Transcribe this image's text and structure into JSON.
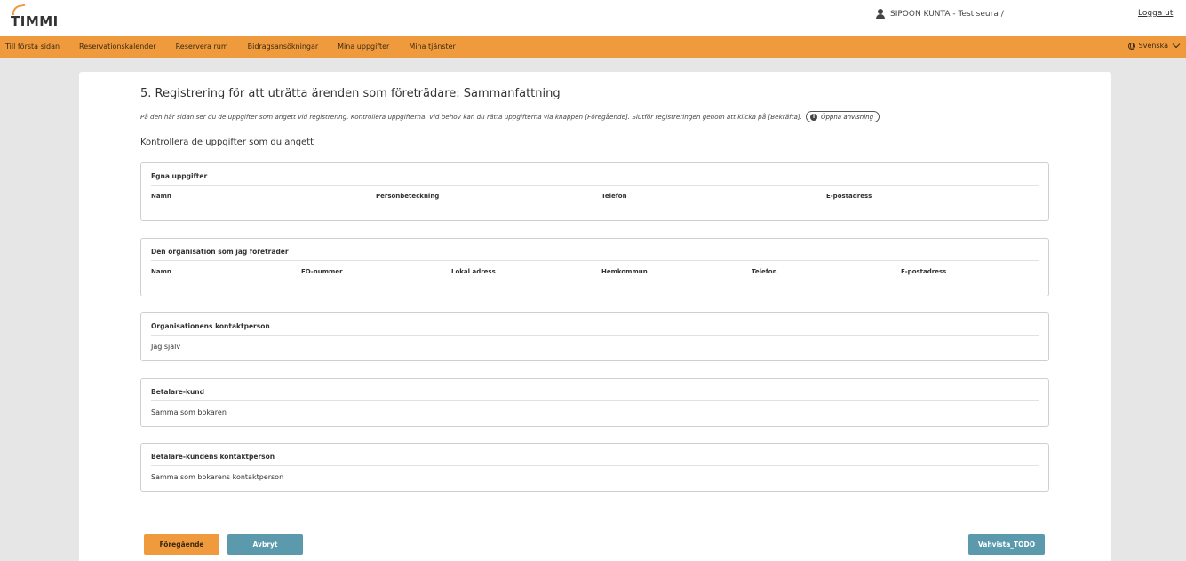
{
  "header": {
    "logo_text": "TIMMI",
    "user_label": "SIPOON KUNTA - Testiseura /",
    "logout_label": "Logga ut"
  },
  "nav": {
    "items": [
      {
        "label": "Till första sidan"
      },
      {
        "label": "Reservationskalender"
      },
      {
        "label": "Reservera rum"
      },
      {
        "label": "Bidragsansökningar"
      },
      {
        "label": "Mina uppgifter"
      },
      {
        "label": "Mina tjänster"
      }
    ],
    "language": "Svenska"
  },
  "main": {
    "title": "5. Registrering för att uträtta ärenden som företrädare: Sammanfattning",
    "intro": "På den här sidan ser du de uppgifter som angett vid registrering. Kontrollera uppgifterna. Vid behov kan du rätta uppgifterna via knappen [Föregående]. Slutför registreringen genom att klicka på [Bekräfta].",
    "guide_button": "Öppna anvisning",
    "subtitle": "Kontrollera de uppgifter som du angett"
  },
  "panels": {
    "own": {
      "title": "Egna uppgifter",
      "columns": [
        "Namn",
        "Personbeteckning",
        "Telefon",
        "E-postadress"
      ]
    },
    "organisation": {
      "title": "Den organisation som jag företräder",
      "columns": [
        "Namn",
        "FO-nummer",
        "Lokal adress",
        "Hemkommun",
        "Telefon",
        "E-postadress"
      ]
    },
    "contact": {
      "title": "Organisationens kontaktperson",
      "value": "Jag själv"
    },
    "payer": {
      "title": "Betalare-kund",
      "value": "Samma som bokaren"
    },
    "payer_contact": {
      "title": "Betalare-kundens kontaktperson",
      "value": "Samma som bokarens kontaktperson"
    }
  },
  "buttons": {
    "previous": "Föregående",
    "cancel": "Avbryt",
    "confirm": "Vahvista_TODO"
  },
  "colors": {
    "accent": "#f09a3e",
    "secondary": "#5b9aad",
    "background": "#e6e6e6"
  }
}
